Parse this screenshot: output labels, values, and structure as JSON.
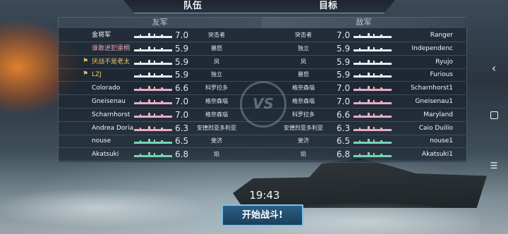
{
  "tabs": {
    "team": "队伍",
    "target": "目标"
  },
  "sides": {
    "friendly": "友军",
    "enemy": "敌军"
  },
  "friendly": [
    {
      "name": "金将军",
      "score": "7.0",
      "type": "突击者",
      "ship_color": "white",
      "style": "normal",
      "flag": false
    },
    {
      "name": "谁敢进犯雷桐",
      "score": "5.9",
      "type": "暴怒",
      "ship_color": "white",
      "style": "red",
      "flag": false
    },
    {
      "name": "厌战不是老太",
      "score": "5.9",
      "type": "凤",
      "ship_color": "white",
      "style": "hl",
      "flag": true
    },
    {
      "name": "LZJ",
      "score": "5.9",
      "type": "独立",
      "ship_color": "white",
      "style": "hl",
      "flag": true
    },
    {
      "name": "Colorado",
      "score": "6.6",
      "type": "科罗拉多",
      "ship_color": "pink",
      "style": "normal",
      "flag": false
    },
    {
      "name": "Gneisenau",
      "score": "7.0",
      "type": "格奈森瑙",
      "ship_color": "pink",
      "style": "normal",
      "flag": false
    },
    {
      "name": "Scharnhorst",
      "score": "7.0",
      "type": "格奈森瑙",
      "ship_color": "pink",
      "style": "normal",
      "flag": false
    },
    {
      "name": "Andrea Doria",
      "score": "6.3",
      "type": "安德烈亚多利亚",
      "ship_color": "pink",
      "style": "normal",
      "flag": false
    },
    {
      "name": "nouse",
      "score": "6.5",
      "type": "斐济",
      "ship_color": "green",
      "style": "normal",
      "flag": false
    },
    {
      "name": "Akatsuki",
      "score": "6.8",
      "type": "焰",
      "ship_color": "green",
      "style": "normal",
      "flag": false
    }
  ],
  "enemy": [
    {
      "name": "Ranger",
      "score": "7.0",
      "type": "突击者",
      "ship_color": "white"
    },
    {
      "name": "Independenc",
      "score": "5.9",
      "type": "独立",
      "ship_color": "white"
    },
    {
      "name": "Ryujo",
      "score": "5.9",
      "type": "凤",
      "ship_color": "white"
    },
    {
      "name": "Furious",
      "score": "5.9",
      "type": "暴怒",
      "ship_color": "white"
    },
    {
      "name": "Scharnhorst1",
      "score": "7.0",
      "type": "格奈森瑙",
      "ship_color": "pink"
    },
    {
      "name": "Gneisenau1",
      "score": "7.0",
      "type": "格奈森瑙",
      "ship_color": "pink"
    },
    {
      "name": "Maryland",
      "score": "6.6",
      "type": "科罗拉多",
      "ship_color": "pink"
    },
    {
      "name": "Caio Duilio",
      "score": "6.3",
      "type": "安德烈亚多利亚",
      "ship_color": "pink"
    },
    {
      "name": "nouse1",
      "score": "6.5",
      "type": "斐济",
      "ship_color": "green"
    },
    {
      "name": "Akatsuki1",
      "score": "6.8",
      "type": "焰",
      "ship_color": "green"
    }
  ],
  "vs_label": "VS",
  "timer": "19:43",
  "start_button": "开始战斗!",
  "nav": {
    "back_icon": "‹",
    "menu_icon": "☰"
  }
}
